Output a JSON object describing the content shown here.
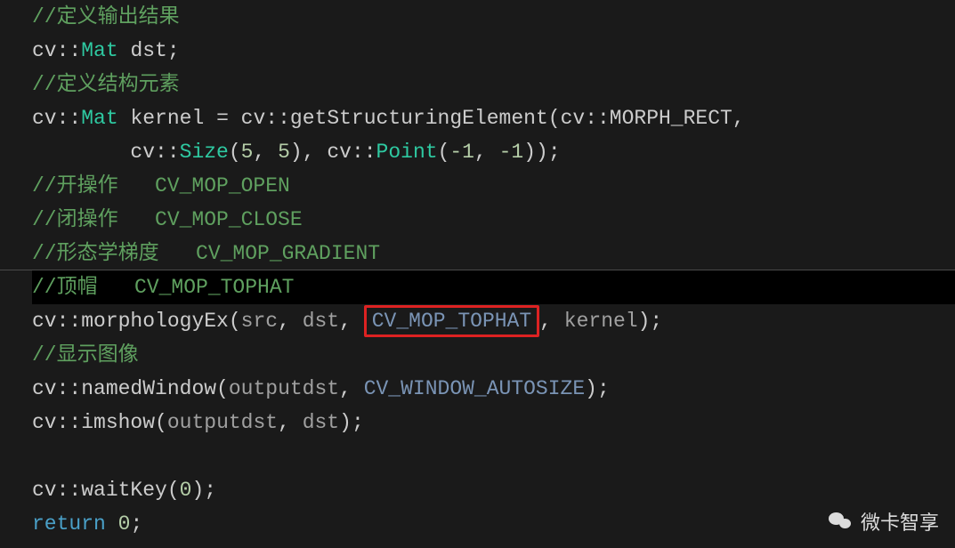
{
  "code": {
    "l1_comment": "//定义输出结果",
    "l2_cv": "cv",
    "l2_colcol": "::",
    "l2_Mat": "Mat",
    "l2_dst": " dst",
    "l2_semi": ";",
    "l3_comment": "//定义结构元素",
    "l4_cv": "cv",
    "l4_colcol1": "::",
    "l4_Mat": "Mat",
    "l4_kernel": " kernel ",
    "l4_eq": "=",
    "l4_sp1": " cv",
    "l4_colcol2": "::",
    "l4_getSE": "getStructuringElement",
    "l4_openp": "(",
    "l4_cvns": "cv",
    "l4_colcol3": "::",
    "l4_MORPH": "MORPH_RECT",
    "l4_comma": ",",
    "l5_indent": "        cv",
    "l5_colcol1": "::",
    "l5_Size": "Size",
    "l5_args1": "(",
    "l5_five1": "5",
    "l5_c1": ", ",
    "l5_five2": "5",
    "l5_close1": ")",
    "l5_c2": ", cv",
    "l5_colcol2": "::",
    "l5_Point": "Point",
    "l5_args2": "(",
    "l5_neg1": "-1",
    "l5_c3": ", ",
    "l5_neg2": "-1",
    "l5_close2": "))",
    "l5_semi": ";",
    "l6_comment": "//开操作   CV_MOP_OPEN",
    "l7_comment": "//闭操作   CV_MOP_CLOSE",
    "l8_comment": "//形态学梯度   CV_MOP_GRADIENT",
    "l9_comment": "//顶帽   CV_MOP_TOPHAT",
    "l10_cv": "cv",
    "l10_colcol": "::",
    "l10_morph": "morphologyEx",
    "l10_open": "(",
    "l10_src": "src",
    "l10_c1": ", ",
    "l10_dst": "dst",
    "l10_c2": ", ",
    "l10_TOPHAT": "CV_MOP_TOPHAT",
    "l10_c3": ", ",
    "l10_kernel": "kernel",
    "l10_close": ")",
    "l10_semi": ";",
    "l11_comment": "//显示图像",
    "l12_cv": "cv",
    "l12_colcol": "::",
    "l12_named": "namedWindow",
    "l12_open": "(",
    "l12_out": "outputdst",
    "l12_c1": ", ",
    "l12_AUTO": "CV_WINDOW_AUTOSIZE",
    "l12_close": ")",
    "l12_semi": ";",
    "l13_cv": "cv",
    "l13_colcol": "::",
    "l13_imshow": "imshow",
    "l13_open": "(",
    "l13_out": "outputdst",
    "l13_c1": ", ",
    "l13_dst": "dst",
    "l13_close": ")",
    "l13_semi": ";",
    "l15_cv": "cv",
    "l15_colcol": "::",
    "l15_wait": "waitKey",
    "l15_open": "(",
    "l15_zero": "0",
    "l15_close": ")",
    "l15_semi": ";",
    "l16_return": "return",
    "l16_sp": " ",
    "l16_zero": "0",
    "l16_semi": ";"
  },
  "watermark": {
    "text": "微卡智享"
  }
}
